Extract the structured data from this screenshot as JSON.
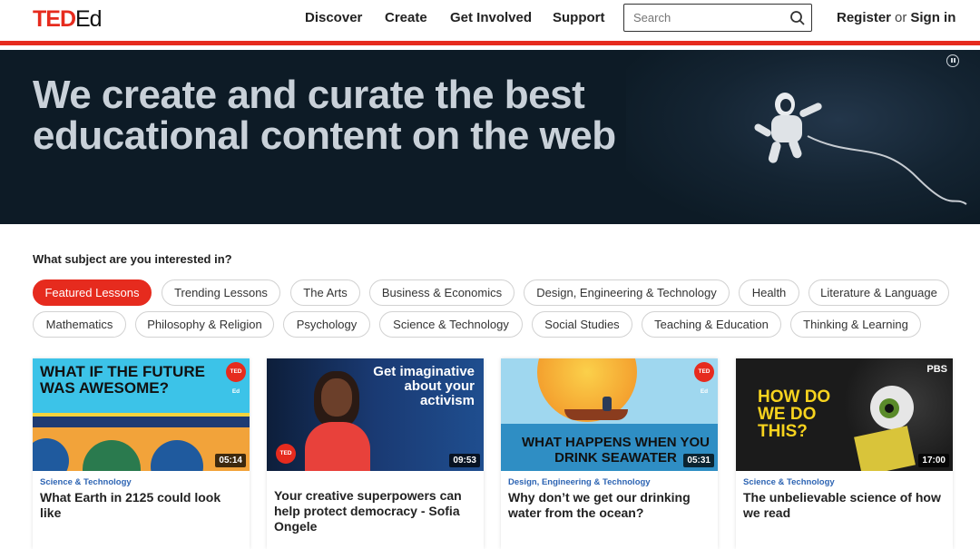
{
  "brand": {
    "logo_ted": "TED",
    "logo_ed": "Ed",
    "accent": "#e62b1e"
  },
  "nav": [
    {
      "label": "Discover"
    },
    {
      "label": "Create"
    },
    {
      "label": "Get Involved"
    },
    {
      "label": "Support"
    }
  ],
  "search": {
    "placeholder": "Search",
    "icon": "search-icon"
  },
  "auth": {
    "register": "Register",
    "or": "or",
    "signin": "Sign in"
  },
  "hero": {
    "title": "We create and curate the best educational content on the web",
    "pause_icon": "pause-icon"
  },
  "subjects": {
    "question": "What subject are you interested in?",
    "row1": [
      "Featured Lessons",
      "Trending Lessons",
      "The Arts",
      "Business & Economics",
      "Design, Engineering & Technology",
      "Health",
      "Literature & Language"
    ],
    "row2": [
      "Mathematics",
      "Philosophy & Religion",
      "Psychology",
      "Science & Technology",
      "Social Studies",
      "Teaching & Education",
      "Thinking & Learning"
    ],
    "active": "Featured Lessons"
  },
  "cards": [
    {
      "category": "Science & Technology",
      "title": "What Earth in 2125 could look like",
      "duration": "05:14",
      "thumb_text": "WHAT IF THE FUTURE WAS AWESOME?",
      "badge": "TED Ed"
    },
    {
      "category": "",
      "title": "Your creative superpowers can help protect democracy - Sofia Ongele",
      "duration": "09:53",
      "thumb_text": "Get imaginative about your activism",
      "badge": "TED"
    },
    {
      "category": "Design, Engineering & Technology",
      "title": "Why don’t we get our drinking water from the ocean?",
      "duration": "05:31",
      "thumb_text": "WHAT HAPPENS WHEN YOU DRINK SEAWATER",
      "badge": "TED Ed"
    },
    {
      "category": "Science & Technology",
      "title": "The unbelievable science of how we read",
      "duration": "17:00",
      "thumb_text": "HOW DO WE DO THIS?",
      "badge": "PBS"
    }
  ]
}
